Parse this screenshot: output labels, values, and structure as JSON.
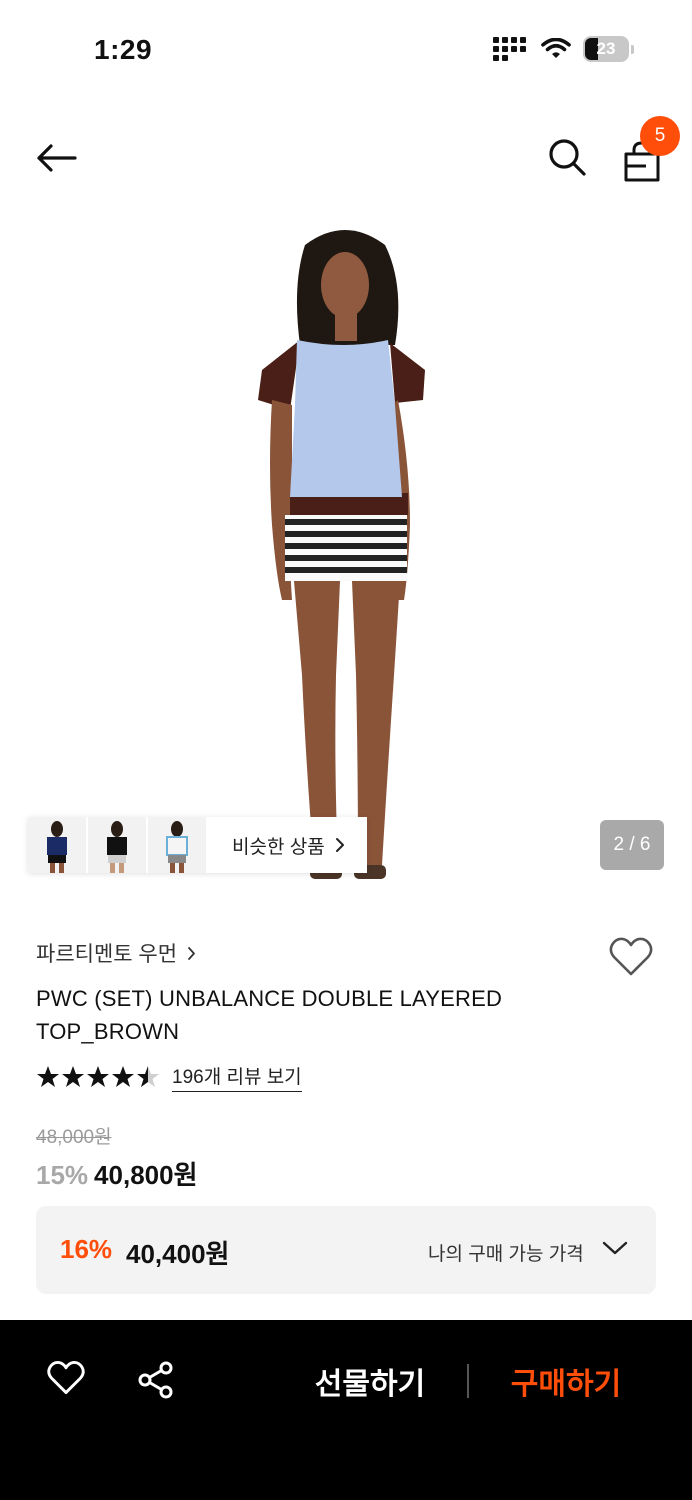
{
  "status_bar": {
    "time": "1:29",
    "battery": "23"
  },
  "header": {
    "cart_count": "5"
  },
  "gallery": {
    "page_indicator": "2 / 6",
    "similar_label": "비슷한 상품",
    "similar_count_thumbnails": 3
  },
  "product": {
    "brand": "파르티멘토 우먼",
    "title": "PWC (SET) UNBALANCE DOUBLE LAYERED TOP_BROWN",
    "rating": 4.5,
    "review_link": "196개 리뷰 보기",
    "original_price": "48,000원",
    "discount_rate": "15%",
    "sale_price": "40,800원"
  },
  "my_price": {
    "discount_rate": "16%",
    "price": "40,400원",
    "label": "나의 구매 가능 가격"
  },
  "bottom_bar": {
    "gift_label": "선물하기",
    "buy_label": "구매하기"
  },
  "colors": {
    "accent": "#ff4d0a",
    "bottom_bar": "#000000"
  }
}
